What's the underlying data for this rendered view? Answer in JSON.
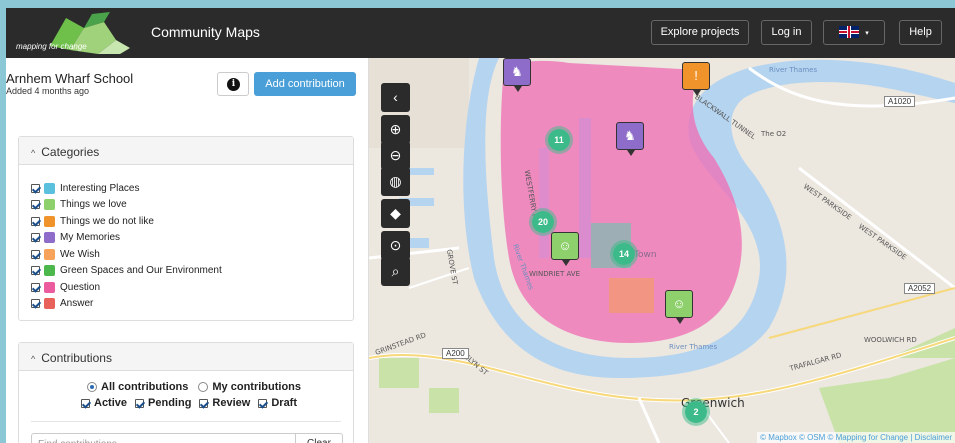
{
  "header": {
    "logo_text": "mapping for change",
    "app_title": "Community Maps",
    "explore_label": "Explore projects",
    "login_label": "Log in",
    "help_label": "Help"
  },
  "project": {
    "title": "Arnhem Wharf School",
    "added": "Added 4 months ago",
    "add_contribution_label": "Add contribution"
  },
  "categories": {
    "heading": "Categories",
    "items": [
      {
        "label": "Interesting Places",
        "color": "#5bc0de"
      },
      {
        "label": "Things we love",
        "color": "#8ed06b"
      },
      {
        "label": "Things we do not like",
        "color": "#f0932b"
      },
      {
        "label": "My Memories",
        "color": "#8e6cc9"
      },
      {
        "label": "We Wish",
        "color": "#f8a35b"
      },
      {
        "label": "Green Spaces and Our Environment",
        "color": "#4cb84c"
      },
      {
        "label": "Question",
        "color": "#ec5b9e"
      },
      {
        "label": "Answer",
        "color": "#e8615a"
      }
    ]
  },
  "contributions": {
    "heading": "Contributions",
    "radio_all": "All contributions",
    "radio_mine": "My contributions",
    "checks": [
      "Active",
      "Pending",
      "Review",
      "Draft"
    ],
    "search_placeholder": "Find contributions...",
    "clear_label": "Clear"
  },
  "map": {
    "clusters": [
      "11",
      "20",
      "14",
      "2"
    ],
    "labels": {
      "river_thames_1": "River Thames",
      "river_thames_2": "River Thames",
      "river_thames_3": "River Thames",
      "o2": "The O2",
      "greenwich": "Greenwich",
      "blackwall": "BLACKWALL TUNNEL",
      "west_parkside": "WEST PARKSIDE",
      "west_parkside2": "WEST PARKSIDE",
      "woolwich": "WOOLWICH RD",
      "trafalgar": "TRAFALGAR RD",
      "grinstead": "GRINSTEAD RD",
      "evelyn": "EVELYN ST",
      "westferry": "WESTFERRY RD",
      "windriet": "WINDRIET AVE",
      "grove": "GROVE ST",
      "town": "Town",
      "a1020": "A1020",
      "a2052": "A2052",
      "a200": "A200"
    },
    "attribution": "© Mapbox © OSM © Mapping for Change | Disclaimer"
  },
  "colors": {
    "accent": "#4a9fd8",
    "topbar": "#2b2b2b",
    "cluster": "#3dba8a",
    "area": "#f06bb4",
    "water": "#b5d4f0"
  }
}
